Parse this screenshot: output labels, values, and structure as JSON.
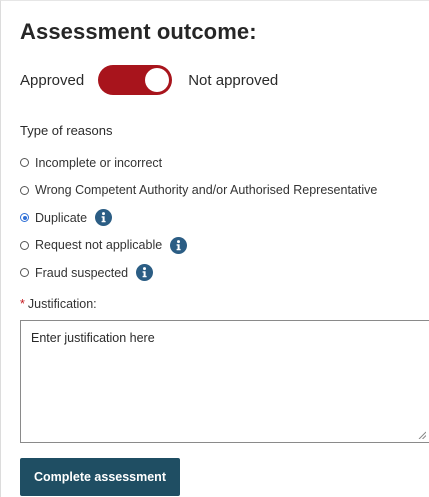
{
  "title": "Assessment outcome:",
  "toggle": {
    "left_label": "Approved",
    "right_label": "Not approved",
    "color": "#a8141c"
  },
  "reasons": {
    "label": "Type of reasons",
    "options": [
      {
        "label": "Incomplete or incorrect",
        "selected": false,
        "info": false
      },
      {
        "label": "Wrong Competent Authority and/or Authorised Representative",
        "selected": false,
        "info": false
      },
      {
        "label": "Duplicate",
        "selected": true,
        "info": true
      },
      {
        "label": "Request not applicable",
        "selected": false,
        "info": true
      },
      {
        "label": "Fraud suspected",
        "selected": false,
        "info": true
      }
    ]
  },
  "justification": {
    "required_marker": "*",
    "label": "Justification:",
    "placeholder": "Enter justification here"
  },
  "submit": {
    "label": "Complete assessment",
    "color": "#1f4e63"
  }
}
